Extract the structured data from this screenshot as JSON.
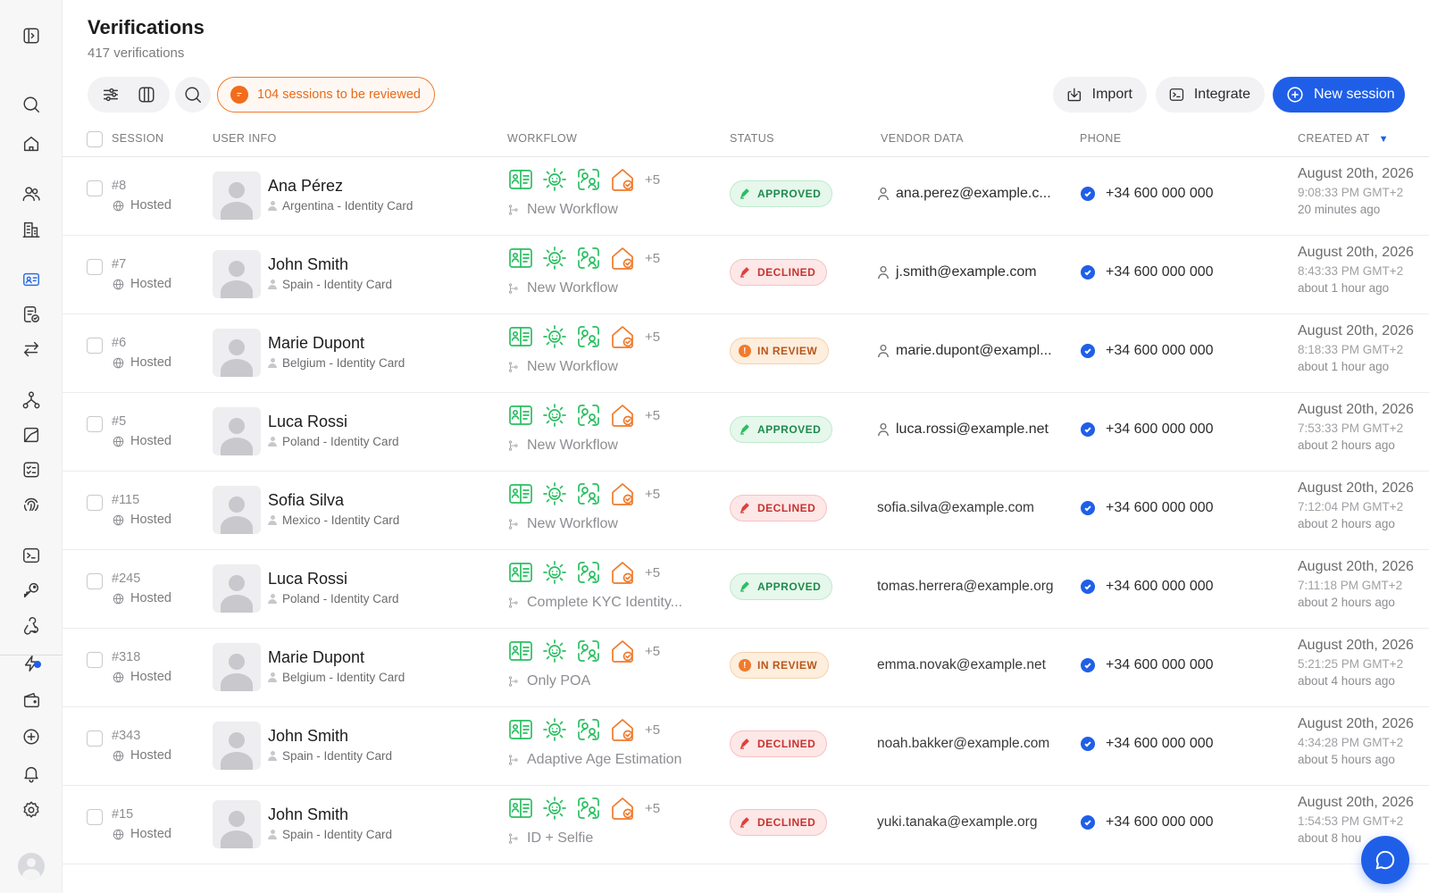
{
  "header": {
    "title": "Verifications",
    "subtitle": "417 verifications"
  },
  "toolbar": {
    "review_label": "104 sessions to be reviewed",
    "import_label": "Import",
    "integrate_label": "Integrate",
    "new_session_label": "New session"
  },
  "columns": {
    "session": "SESSION",
    "user_info": "USER INFO",
    "workflow": "WORKFLOW",
    "status": "STATUS",
    "vendor_data": "VENDOR DATA",
    "phone": "PHONE",
    "created_at": "CREATED AT"
  },
  "sidebar_icons": [
    "collapse-sidebar-icon",
    "search-icon",
    "home-icon",
    "users-icon",
    "buildings-icon",
    "id-card-icon",
    "document-check-icon",
    "transfer-icon",
    "workflow-icon",
    "analytics-icon",
    "checklist-icon",
    "fingerprint-icon",
    "terminal-icon",
    "key-icon",
    "webhook-icon",
    "lightning-icon",
    "wallet-icon",
    "plus-circle-icon",
    "bell-icon",
    "settings-icon"
  ],
  "colors": {
    "primary": "#1f5fe8",
    "review_orange": "#ea6a17",
    "workflow_green": "#2bbf62",
    "workflow_orange": "#ef7a2c",
    "approved": "#1e8a4c",
    "declined": "#c7332f",
    "in_review": "#b8551a"
  },
  "rows": [
    {
      "id": "#8",
      "type": "Hosted",
      "name": "Ana Pérez",
      "sub": "Argentina - Identity Card",
      "more": "+5",
      "workflow": "New Workflow",
      "status": "APPROVED",
      "status_kind": "approved",
      "vendor": "ana.perez@example.c...",
      "vendor_icon": true,
      "phone": "+34 600 000 000",
      "date": "August 20th, 2026",
      "time": "9:08:33 PM GMT+2",
      "ago": "20 minutes ago"
    },
    {
      "id": "#7",
      "type": "Hosted",
      "name": "John Smith",
      "sub": "Spain - Identity Card",
      "more": "+5",
      "workflow": "New Workflow",
      "status": "DECLINED",
      "status_kind": "declined",
      "vendor": "j.smith@example.com",
      "vendor_icon": true,
      "phone": "+34 600 000 000",
      "date": "August 20th, 2026",
      "time": "8:43:33 PM GMT+2",
      "ago": "about 1 hour ago"
    },
    {
      "id": "#6",
      "type": "Hosted",
      "name": "Marie Dupont",
      "sub": "Belgium - Identity Card",
      "more": "+5",
      "workflow": "New Workflow",
      "status": "IN REVIEW",
      "status_kind": "review",
      "vendor": "marie.dupont@exampl...",
      "vendor_icon": true,
      "phone": "+34 600 000 000",
      "date": "August 20th, 2026",
      "time": "8:18:33 PM GMT+2",
      "ago": "about 1 hour ago"
    },
    {
      "id": "#5",
      "type": "Hosted",
      "name": "Luca Rossi",
      "sub": "Poland - Identity Card",
      "more": "+5",
      "workflow": "New Workflow",
      "status": "APPROVED",
      "status_kind": "approved",
      "vendor": "luca.rossi@example.net",
      "vendor_icon": true,
      "phone": "+34 600 000 000",
      "date": "August 20th, 2026",
      "time": "7:53:33 PM GMT+2",
      "ago": "about 2 hours ago"
    },
    {
      "id": "#115",
      "type": "Hosted",
      "name": "Sofia Silva",
      "sub": "Mexico - Identity Card",
      "more": "+5",
      "workflow": "New Workflow",
      "status": "DECLINED",
      "status_kind": "declined",
      "vendor": "sofia.silva@example.com",
      "vendor_icon": false,
      "phone": "+34 600 000 000",
      "date": "August 20th, 2026",
      "time": "7:12:04 PM GMT+2",
      "ago": "about 2 hours ago"
    },
    {
      "id": "#245",
      "type": "Hosted",
      "name": "Luca Rossi",
      "sub": "Poland - Identity Card",
      "more": "+5",
      "workflow": "Complete KYC Identity...",
      "status": "APPROVED",
      "status_kind": "approved",
      "vendor": "tomas.herrera@example.org",
      "vendor_icon": false,
      "phone": "+34 600 000 000",
      "date": "August 20th, 2026",
      "time": "7:11:18 PM GMT+2",
      "ago": "about 2 hours ago"
    },
    {
      "id": "#318",
      "type": "Hosted",
      "name": "Marie Dupont",
      "sub": "Belgium - Identity Card",
      "more": "+5",
      "workflow": "Only POA",
      "status": "IN REVIEW",
      "status_kind": "review",
      "vendor": "emma.novak@example.net",
      "vendor_icon": false,
      "phone": "+34 600 000 000",
      "date": "August 20th, 2026",
      "time": "5:21:25 PM GMT+2",
      "ago": "about 4 hours ago"
    },
    {
      "id": "#343",
      "type": "Hosted",
      "name": "John Smith",
      "sub": "Spain - Identity Card",
      "more": "+5",
      "workflow": "Adaptive Age Estimation",
      "status": "DECLINED",
      "status_kind": "declined",
      "vendor": "noah.bakker@example.com",
      "vendor_icon": false,
      "phone": "+34 600 000 000",
      "date": "August 20th, 2026",
      "time": "4:34:28 PM GMT+2",
      "ago": "about 5 hours ago"
    },
    {
      "id": "#15",
      "type": "Hosted",
      "name": "John Smith",
      "sub": "Spain - Identity Card",
      "more": "+5",
      "workflow": "ID + Selfie",
      "status": "DECLINED",
      "status_kind": "declined",
      "vendor": "yuki.tanaka@example.org",
      "vendor_icon": false,
      "phone": "+34 600 000 000",
      "date": "August 20th, 2026",
      "time": "1:54:53 PM GMT+2",
      "ago": "about 8 hou"
    }
  ]
}
